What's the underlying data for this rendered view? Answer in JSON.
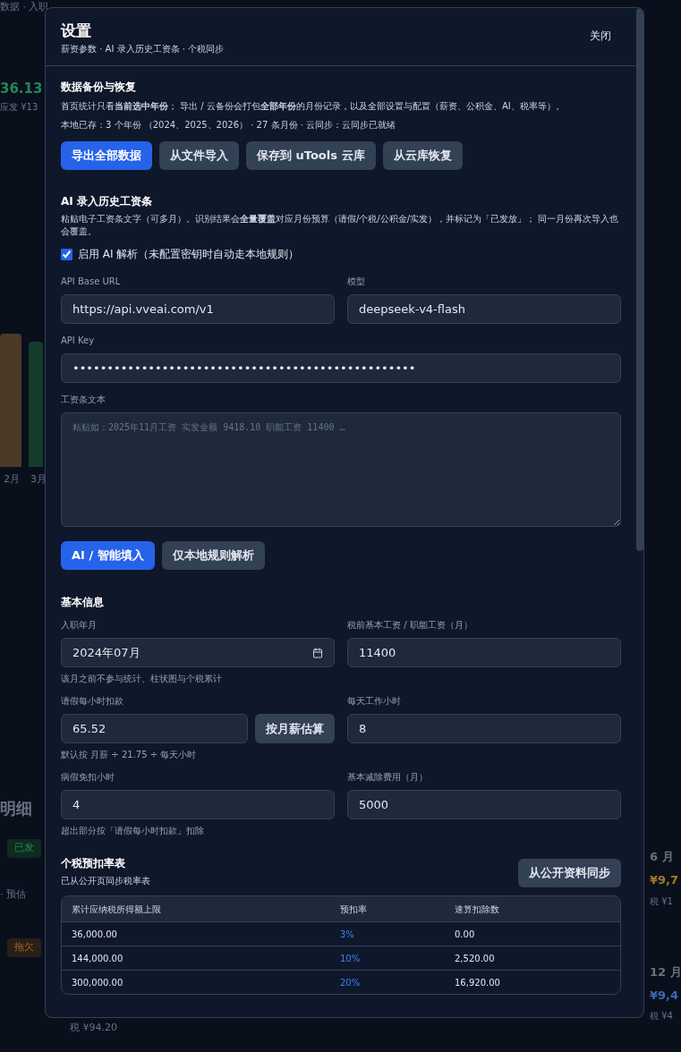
{
  "background": [
    {
      "kind": "muted",
      "text": "数据 · 入职"
    },
    {
      "kind": "amount",
      "text": "36.13"
    },
    {
      "kind": "muted",
      "text": "应发 ¥13"
    },
    {
      "kind": "axis",
      "text": "2月"
    },
    {
      "kind": "axis",
      "text": "3月"
    },
    {
      "kind": "heading",
      "text": "明细"
    },
    {
      "kind": "paid",
      "text": "已发"
    },
    {
      "kind": "muted",
      "text": "· 预估"
    },
    {
      "kind": "owed",
      "text": "拖欠"
    },
    {
      "kind": "muted",
      "text": "税 ¥94.20"
    },
    {
      "kind": "month",
      "text": "6 月"
    },
    {
      "kind": "owed_amount",
      "text": "¥9,7"
    },
    {
      "kind": "muted",
      "text": "税 ¥1"
    },
    {
      "kind": "month",
      "text": "12 月"
    },
    {
      "kind": "paid_amount",
      "text": "¥9,4"
    },
    {
      "kind": "muted",
      "text": "税 ¥4"
    }
  ],
  "modal": {
    "title": "设置",
    "subtitle": "薪资参数 · AI 录入历史工资条 · 个税同步",
    "close_button": "关闭",
    "backup": {
      "title": "数据备份与恢复",
      "description": "首页统计只看**当前选中年份**； 导出 / 云备份会打包**全部年份**的月份记录，以及全部设置与配置（薪资、公积金、AI、税率等）。",
      "status": "本地已存：3 个年份 （2024、2025、2026） · 27 条月份 · 云同步：云同步已就绪",
      "buttons": [
        {
          "label": "导出全部数据",
          "primary": true
        },
        {
          "label": "从文件导入",
          "primary": false
        },
        {
          "label": "保存到 uTools 云库",
          "primary": false
        },
        {
          "label": "从云库恢复",
          "primary": false
        }
      ]
    },
    "ai": {
      "title": "AI 录入历史工资条",
      "description": "粘贴电子工资条文字（可多月）。识别结果会**全量覆盖**对应月份预算（请假/个税/公积金/实发），并标记为「已发放」； 同一月份再次导入也会覆盖。",
      "checkbox": {
        "label": "启用 AI 解析（未配置密钥时自动走本地规则）",
        "checked": true
      },
      "base_url": {
        "label": "API Base URL",
        "value": "https://api.vveai.com/v1"
      },
      "model": {
        "label": "模型",
        "value": "deepseek-v4-flash"
      },
      "api_key": {
        "label": "API Key",
        "value": "••••••••••••••••••••••••••••••••••••••••••••••••••"
      },
      "payslip": {
        "label": "工资条文本",
        "placeholder": "粘贴如：2025年11月工资 实发金额 9418.10 职能工资 11400 …"
      },
      "buttons": [
        {
          "label": "AI / 智能填入",
          "primary": true
        },
        {
          "label": "仅本地规则解析",
          "primary": false
        }
      ]
    },
    "basic": {
      "title": "基本信息",
      "fields": [
        {
          "kind": "date",
          "label": "入职年月",
          "value": "2024年07月",
          "hint": "该月之前不参与统计、柱状图与个税累计"
        },
        {
          "kind": "text",
          "label": "税前基本工资 / 职能工资（月）",
          "value": "11400"
        },
        {
          "kind": "with_button",
          "label": "请假每小时扣款",
          "value": "65.52",
          "button": "按月薪估算",
          "hint": "默认按 月薪 ÷ 21.75 ÷ 每天小时"
        },
        {
          "kind": "text",
          "label": "每天工作小时",
          "value": "8"
        },
        {
          "kind": "text",
          "label": "病假免扣小时",
          "value": "4",
          "hint": "超出部分按「请假每小时扣款」扣除"
        },
        {
          "kind": "text",
          "label": "基本减除费用（月）",
          "value": "5000"
        }
      ]
    },
    "tax": {
      "title": "个税预扣率表",
      "subtitle": "已从公开页同步税率表",
      "sync_button": "从公开资料同步",
      "columns": [
        "累计应纳税所得额上限",
        "预扣率",
        "速算扣除数"
      ],
      "rows": [
        [
          "36,000.00",
          "3%",
          "0.00"
        ],
        [
          "144,000.00",
          "10%",
          "2,520.00"
        ],
        [
          "300,000.00",
          "20%",
          "16,920.00"
        ]
      ]
    }
  }
}
